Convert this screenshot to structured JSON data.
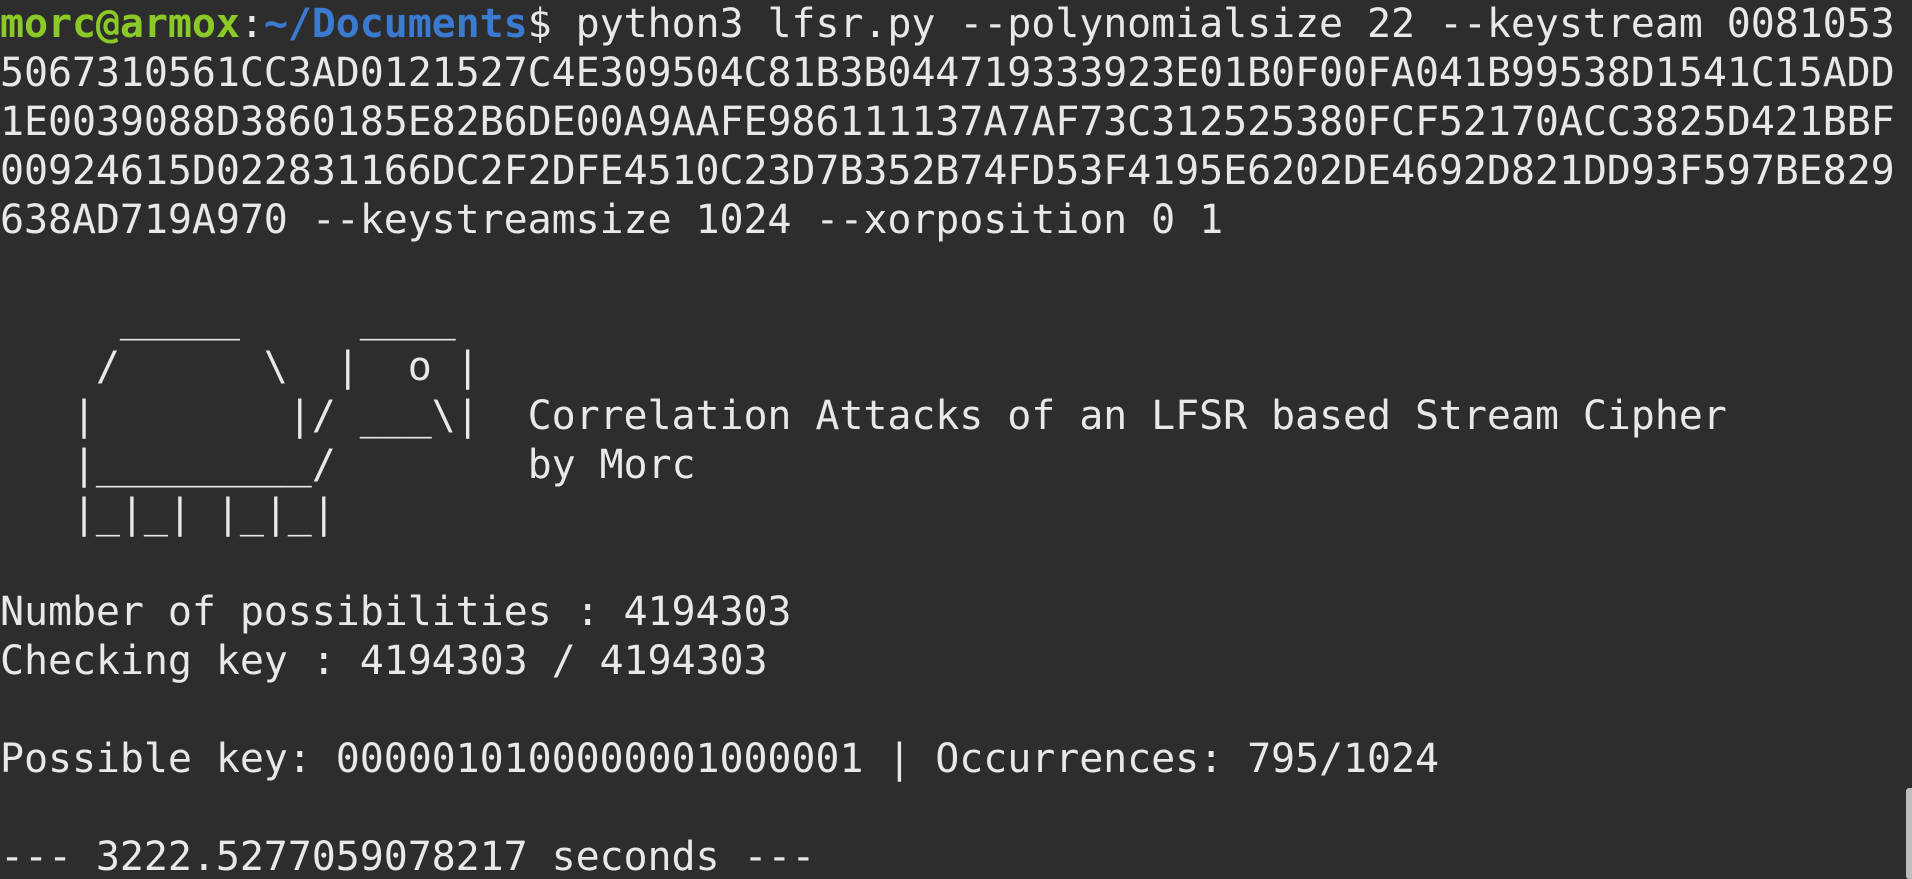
{
  "prompt": {
    "user_host": "morc@armox",
    "separator": ":",
    "path": "~/Documents",
    "symbol": "$"
  },
  "command_lines": [
    " python3 lfsr.py --polynomialsize 22 --keystream 0081053",
    "5067310561CC3AD0121527C4E309504C81B3B044719333923E01B0F00FA041B99538D1541C15ADD",
    "1E0039088D3860185E82B6DE00A9AAFE986111137A7AF73C312525380FCF52170ACC3825D421BBF",
    "00924615D022831166DC2F2DFE4510C23D7B352B74FD53F4195E6202DE4692D821DD93F597BE829",
    "638AD719A970 --keystreamsize 1024 --xorposition 0 1"
  ],
  "banner_lines": [
    "     _____     ____",
    "    /      \\  |  o |",
    "   |        |/ ___\\|  Correlation Attacks of an LFSR based Stream Cipher",
    "   |_________/        by Morc",
    "   |_|_| |_|_|"
  ],
  "output_lines": [
    "Number of possibilities : 4194303",
    "Checking key : 4194303 / 4194303",
    "",
    "Possible key: 0000010100000001000001 | Occurrences: 795/1024",
    "",
    "--- 3222.5277059078217 seconds ---"
  ],
  "colors": {
    "background": "#2d2d2d",
    "text": "#e8e8e8",
    "user_host": "#8ac926",
    "path": "#3a7ad1"
  }
}
